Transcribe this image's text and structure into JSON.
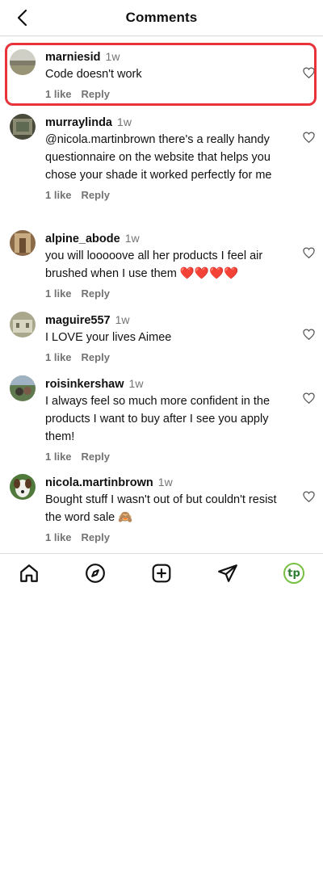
{
  "header": {
    "title": "Comments"
  },
  "comments": [
    {
      "username": "marniesid",
      "time": "1w",
      "text": "Code doesn't work",
      "likes": "1 like",
      "reply": "Reply"
    },
    {
      "username": "murraylinda",
      "time": "1w",
      "text": "@nicola.martinbrown there's a really handy questionnaire on the website that helps you chose your shade it worked perfectly for me",
      "likes": "1 like",
      "reply": "Reply"
    },
    {
      "username": "alpine_abode",
      "time": "1w",
      "text": "you will looooove all her products I feel air brushed when I use them ❤️❤️❤️❤️",
      "likes": "1 like",
      "reply": "Reply"
    },
    {
      "username": "maguire557",
      "time": "1w",
      "text": "I LOVE your lives Aimee",
      "likes": "1 like",
      "reply": "Reply"
    },
    {
      "username": "roisinkershaw",
      "time": "1w",
      "text": "I always feel so much more confident in the products I want to buy after I see you apply them!",
      "likes": "1 like",
      "reply": "Reply"
    },
    {
      "username": "nicola.martinbrown",
      "time": "1w",
      "text": "Bought stuff I wasn't out of but couldn't resist the word sale 🙈",
      "likes": "1 like",
      "reply": "Reply"
    }
  ],
  "nav": {
    "profile_initials": "tp"
  },
  "colors": {
    "highlight": "#e8333b",
    "profile_ring": "#78c043",
    "muted": "#737373"
  }
}
